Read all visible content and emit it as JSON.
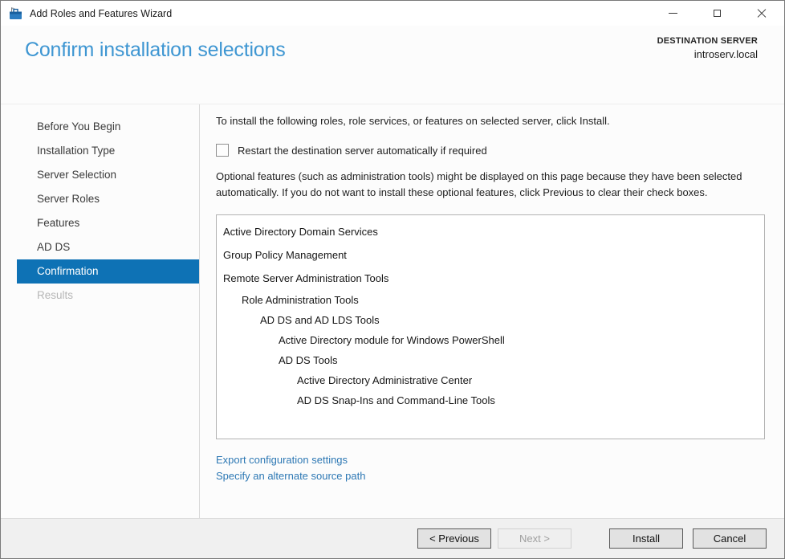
{
  "window": {
    "title": "Add Roles and Features Wizard"
  },
  "header": {
    "title": "Confirm installation selections",
    "destination_label": "DESTINATION SERVER",
    "destination_server": "introserv.local"
  },
  "sidebar": {
    "items": [
      {
        "label": "Before You Begin",
        "state": "normal"
      },
      {
        "label": "Installation Type",
        "state": "normal"
      },
      {
        "label": "Server Selection",
        "state": "normal"
      },
      {
        "label": "Server Roles",
        "state": "normal"
      },
      {
        "label": "Features",
        "state": "normal"
      },
      {
        "label": "AD DS",
        "state": "normal"
      },
      {
        "label": "Confirmation",
        "state": "selected"
      },
      {
        "label": "Results",
        "state": "disabled"
      }
    ]
  },
  "content": {
    "intro": "To install the following roles, role services, or features on selected server, click Install.",
    "restart_checkbox": {
      "label": "Restart the destination server automatically if required",
      "checked": false
    },
    "optional_note": "Optional features (such as administration tools) might be displayed on this page because they have been selected automatically. If you do not want to install these optional features, click Previous to clear their check boxes.",
    "selections": [
      {
        "label": "Active Directory Domain Services",
        "indent": 0
      },
      {
        "label": "Group Policy Management",
        "indent": 0
      },
      {
        "label": "Remote Server Administration Tools",
        "indent": 0
      },
      {
        "label": "Role Administration Tools",
        "indent": 1
      },
      {
        "label": "AD DS and AD LDS Tools",
        "indent": 2
      },
      {
        "label": "Active Directory module for Windows PowerShell",
        "indent": 3
      },
      {
        "label": "AD DS Tools",
        "indent": 3
      },
      {
        "label": "Active Directory Administrative Center",
        "indent": 4
      },
      {
        "label": "AD DS Snap-Ins and Command-Line Tools",
        "indent": 4
      }
    ],
    "links": [
      {
        "label": "Export configuration settings"
      },
      {
        "label": "Specify an alternate source path"
      }
    ]
  },
  "footer": {
    "buttons": [
      {
        "label": "< Previous",
        "state": "enabled"
      },
      {
        "label": "Next >",
        "state": "disabled"
      },
      {
        "label": "Install",
        "state": "enabled"
      },
      {
        "label": "Cancel",
        "state": "enabled"
      }
    ]
  },
  "colors": {
    "nav-selected": "#0e72b5",
    "heading": "#3e96d2",
    "link": "#2d78b4"
  }
}
